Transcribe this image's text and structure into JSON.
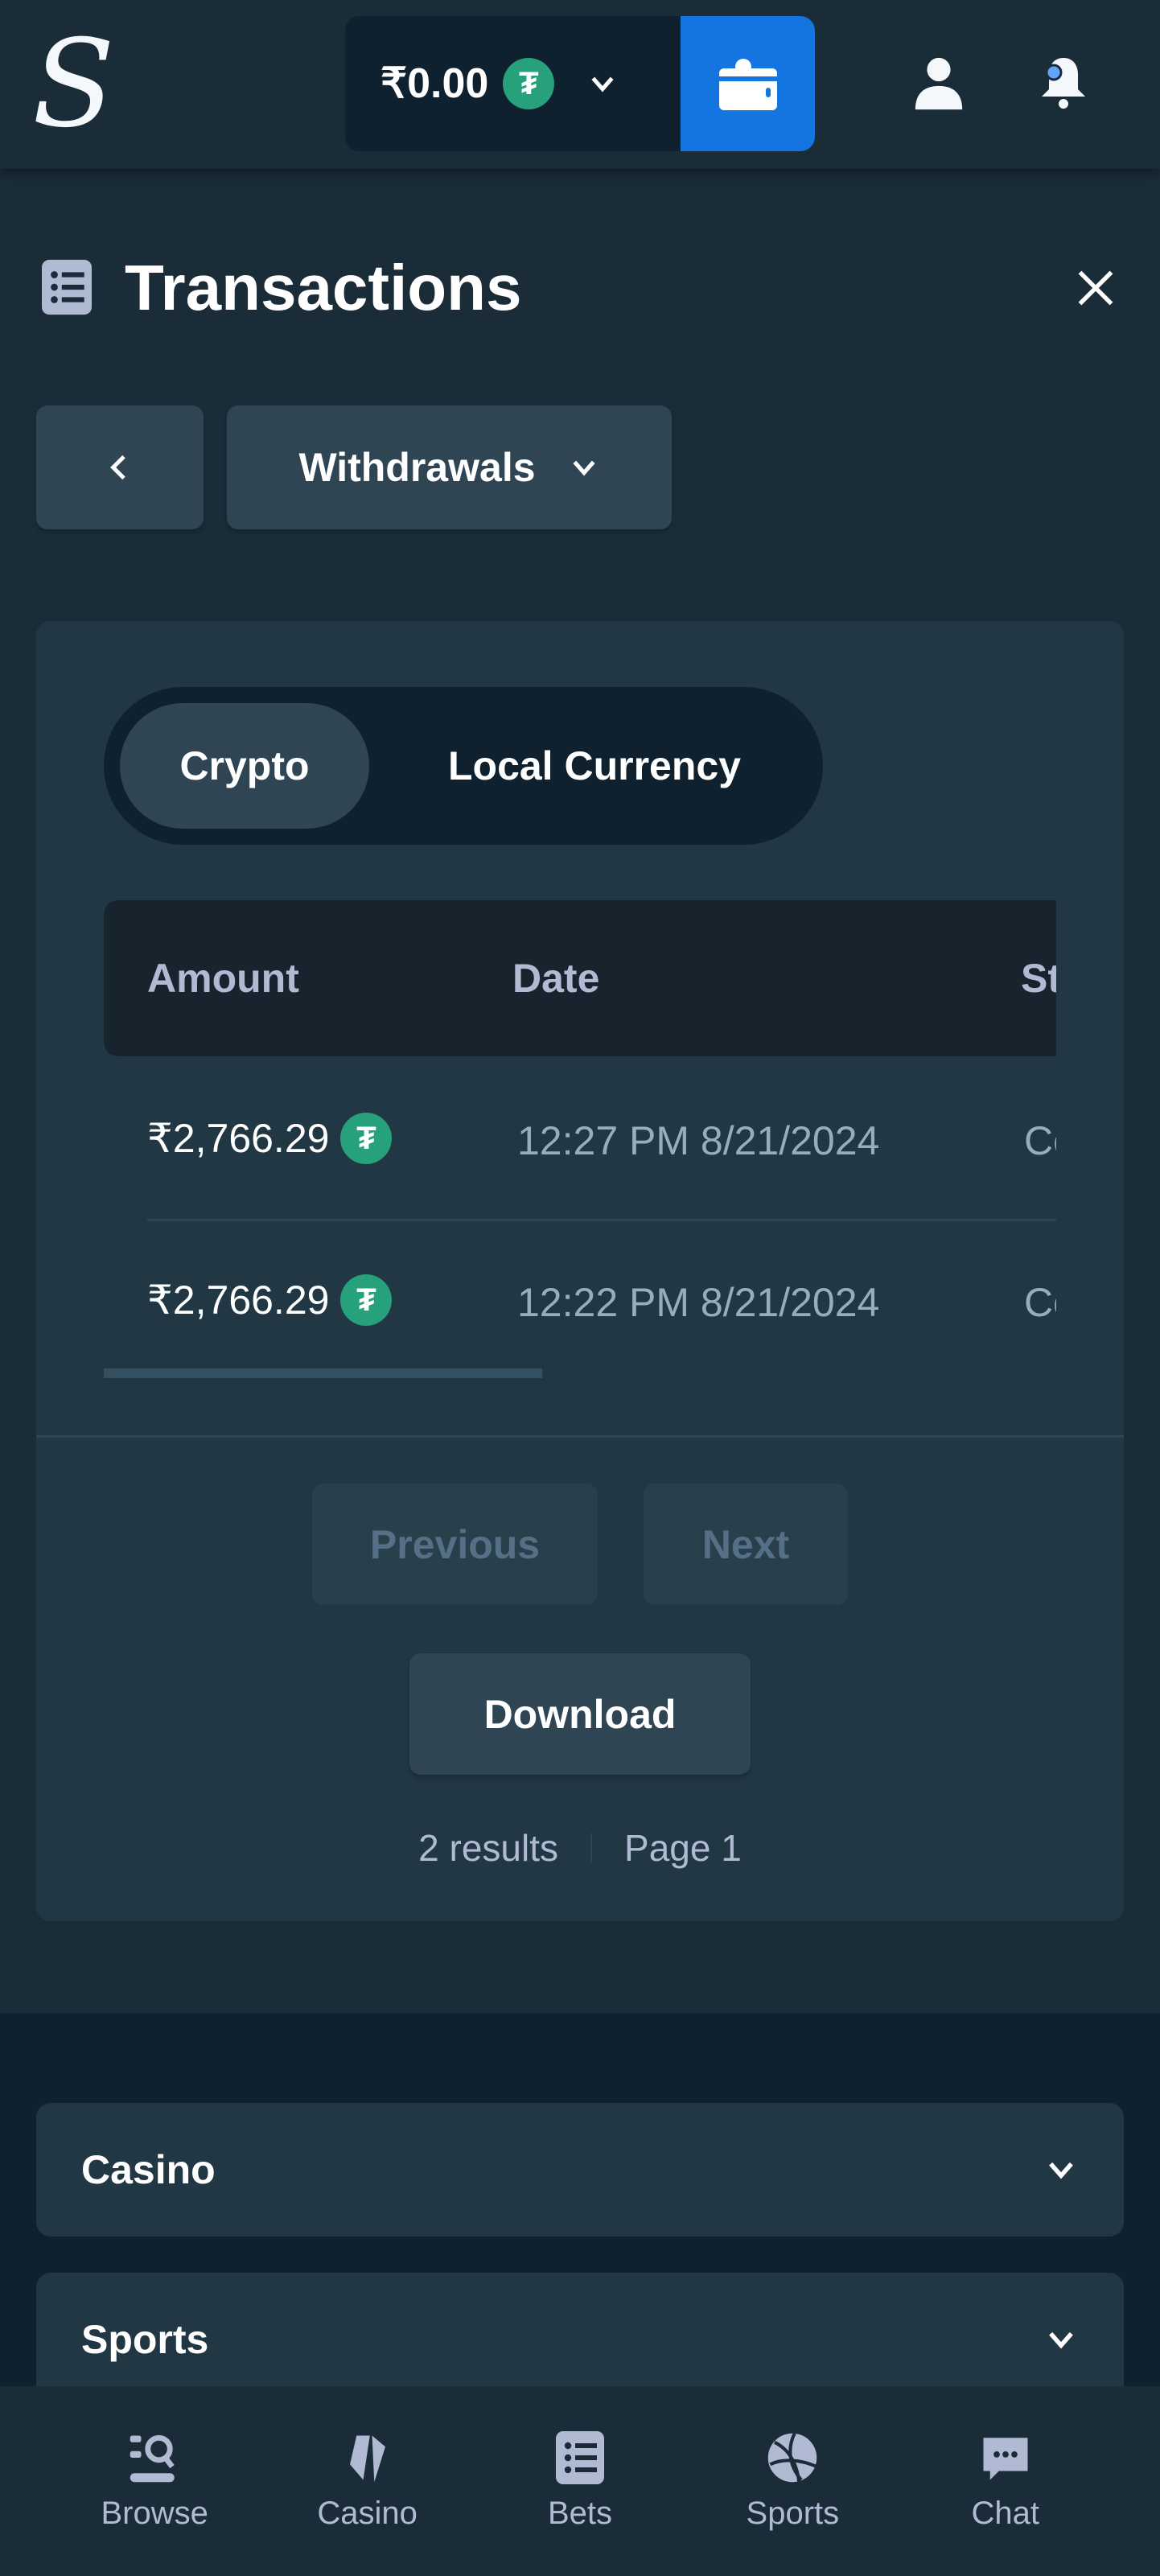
{
  "header": {
    "logo": "S",
    "balance": "₹0.00",
    "currency_icon": "usdt-icon"
  },
  "page": {
    "title": "Transactions",
    "filter": "Withdrawals"
  },
  "tabs": [
    {
      "label": "Crypto",
      "active": true
    },
    {
      "label": "Local Currency",
      "active": false
    }
  ],
  "table": {
    "columns": [
      "Amount",
      "Date",
      "St"
    ],
    "rows": [
      {
        "amount": "₹2,766.29",
        "date": "12:27 PM 8/21/2024",
        "status": "Co"
      },
      {
        "amount": "₹2,766.29",
        "date": "12:22 PM 8/21/2024",
        "status": "Co"
      }
    ]
  },
  "pagination": {
    "previous": "Previous",
    "next": "Next",
    "download": "Download",
    "results": "2 results",
    "page": "Page 1"
  },
  "footer": {
    "sections": [
      "Casino",
      "Sports"
    ]
  },
  "nav": [
    "Browse",
    "Casino",
    "Bets",
    "Sports",
    "Chat"
  ],
  "colors": {
    "accent": "#1475e1",
    "usdt": "#26a17b",
    "bg": "#1a2c38",
    "card": "#213743"
  }
}
